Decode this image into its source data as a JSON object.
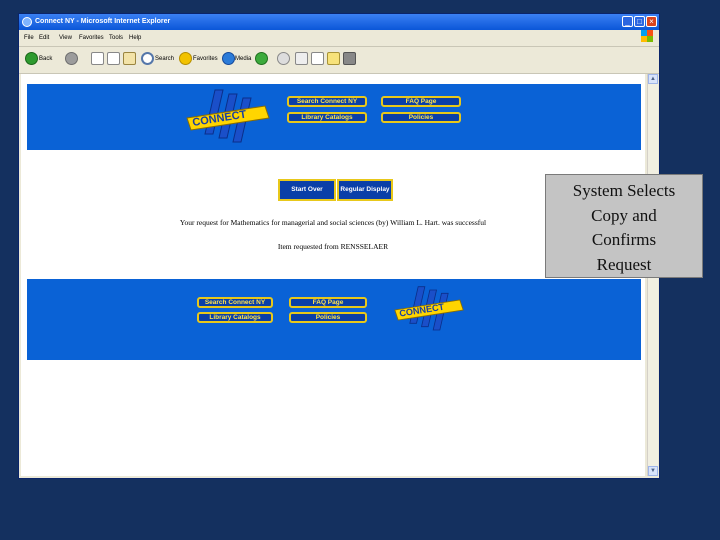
{
  "window": {
    "title": "Connect NY - Microsoft Internet Explorer",
    "controls": [
      "minimize",
      "maximize",
      "close"
    ]
  },
  "menu": [
    "File",
    "Edit",
    "View",
    "Favorites",
    "Tools",
    "Help"
  ],
  "toolbar": {
    "back_label": "Back",
    "search_label": "Search",
    "favorites_label": "Favorites",
    "media_label": "Media"
  },
  "page": {
    "logo_text": "CONNECT",
    "logo_small": "NY",
    "nav": {
      "search": "Search Connect NY",
      "faq": "FAQ Page",
      "catalogs": "Library Catalogs",
      "policies": "Policies"
    },
    "buttons": {
      "start_over": "Start Over",
      "regular_display": "Regular Display"
    },
    "message": "Your request for Mathematics for managerial and social sciences (by) William L. Hart. was successful",
    "requested_from": "Item requested from RENSSELAER"
  },
  "callout": {
    "lines": [
      "System Selects",
      "Copy and",
      "Confirms",
      "Request"
    ]
  },
  "colors": {
    "background": "#14305f",
    "band": "#0a62d6",
    "button_border": "#e8c81a",
    "button_text": "#ffe34b",
    "callout": "#c4c4c4"
  }
}
